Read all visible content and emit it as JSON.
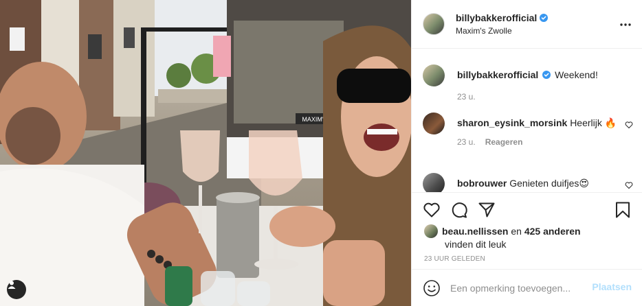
{
  "post": {
    "author": "billybakkerofficial",
    "location": "Maxim's Zwolle",
    "caption": "Weekend!",
    "caption_time": "23 u.",
    "photo_sign": "MAXIM'S"
  },
  "comments": [
    {
      "user": "sharon_eysink_morsink",
      "text": "Heerlijk 🔥",
      "time": "23 u.",
      "reply": "Reageren"
    },
    {
      "user": "bobrouwer",
      "text": "Genieten duifjes😍"
    }
  ],
  "likes": {
    "user": "beau.nellissen",
    "conj": "en",
    "others": "425 anderen",
    "suffix": "vinden dit leuk"
  },
  "timestamp": "23 UUR GELEDEN",
  "composer": {
    "placeholder": "Een opmerking toevoegen...",
    "post_label": "Plaatsen"
  },
  "colors": {
    "verified": "#3897f0",
    "post_disabled": "#b2dffc",
    "muted": "#8e8e8e"
  }
}
